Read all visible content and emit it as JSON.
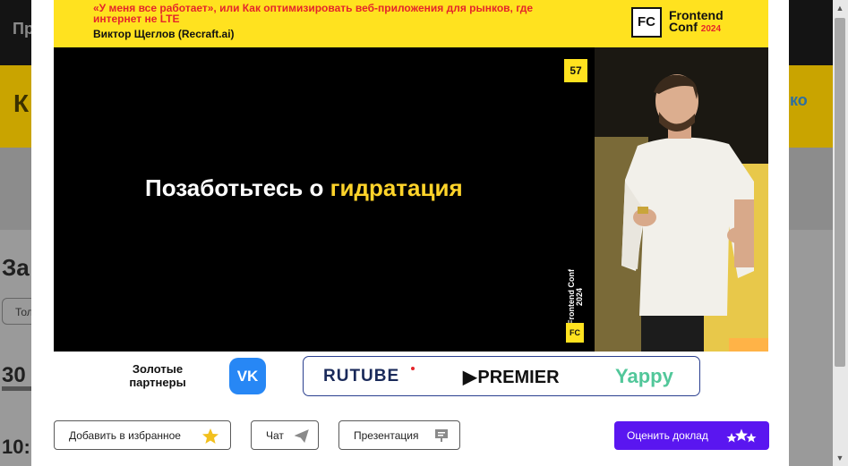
{
  "background": {
    "top_bar_text": "Пр",
    "yellow_band_text": "К",
    "yellow_band_logo": "ко",
    "heading": "За",
    "pill": "Тол",
    "time_1": "30",
    "time_2": "10:"
  },
  "banner": {
    "title": "«У меня все работает», или Как оптимизировать веб-приложения для рынков, где интернет не LTE",
    "speaker": "Виктор Щеглов (Recraft.ai)",
    "logo_badge": "FC",
    "logo_name_1": "Frontend",
    "logo_name_2": "Conf",
    "logo_year": "2024"
  },
  "video": {
    "slide_text": "Позаботьтесь о",
    "slide_accent": "гидратация",
    "slide_number": "57",
    "corner_logo_badge": "FC",
    "corner_logo_text": "Frontend Conf 2024"
  },
  "partners": {
    "gold_label": "Золотые партнеры",
    "vk": "VK",
    "rutube": "RUTUBE",
    "premier": "PREMIER",
    "yappy": "Yappy"
  },
  "actions": {
    "favorite": "Добавить в избранное",
    "chat": "Чат",
    "presentation": "Презентация",
    "rate": "Оценить доклад"
  },
  "colors": {
    "banner_yellow": "#ffe21f",
    "accent_red": "#e5252b",
    "rate_purple": "#5a16f0",
    "vk_blue": "#2787f5",
    "slide_accent": "#ffd42a"
  },
  "icons": {
    "favorite": "star-icon",
    "chat": "send-icon",
    "presentation": "presentation-icon",
    "rate": "stars-icon"
  }
}
